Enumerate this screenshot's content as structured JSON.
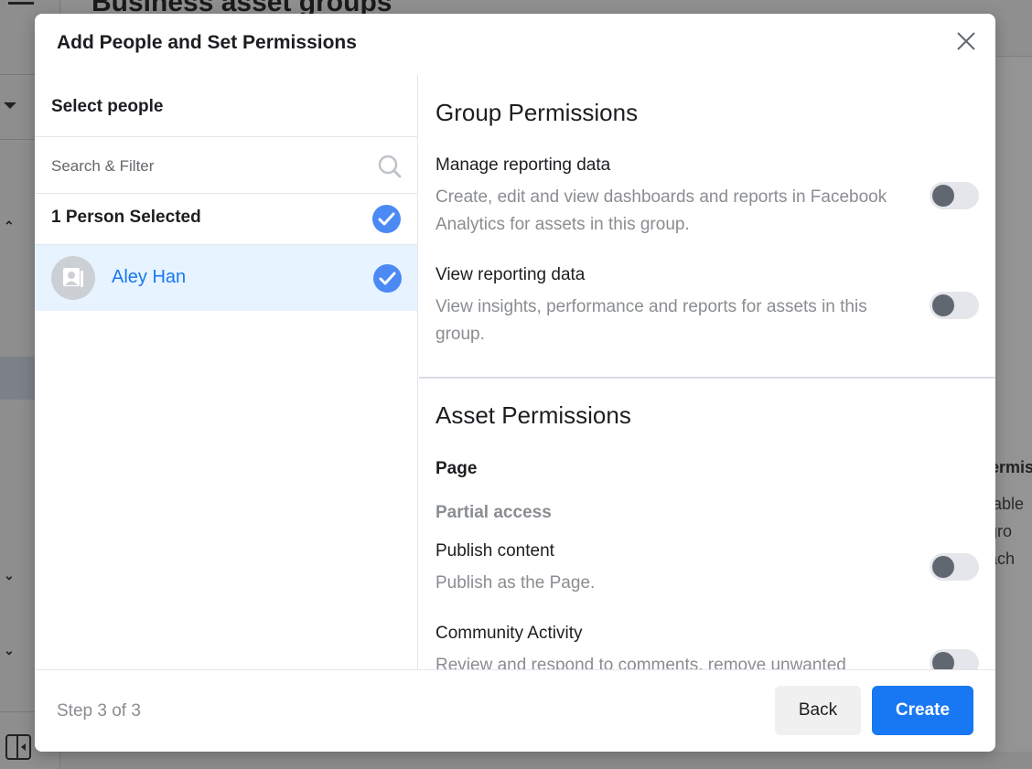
{
  "background": {
    "page_title": "Business asset groups",
    "side_text": {
      "heading": "Permiss",
      "lines": [
        "e able",
        "t gro",
        "each"
      ]
    }
  },
  "modal": {
    "title": "Add People and Set Permissions",
    "close_icon": "close-icon",
    "left": {
      "heading": "Select people",
      "search": {
        "placeholder": "Search & Filter",
        "value": ""
      },
      "selected_count_label": "1 Person Selected",
      "people": [
        {
          "name": "Aley Han",
          "selected": true
        }
      ]
    },
    "right": {
      "group_permissions": {
        "title": "Group Permissions",
        "items": [
          {
            "title": "Manage reporting data",
            "description": "Create, edit and view dashboards and reports in Facebook Analytics for assets in this group.",
            "enabled": false
          },
          {
            "title": "View reporting data",
            "description": "View insights, performance and reports for assets in this group.",
            "enabled": false
          }
        ]
      },
      "asset_permissions": {
        "title": "Asset Permissions",
        "asset_type": "Page",
        "access_level": "Partial access",
        "items": [
          {
            "title": "Publish content",
            "description": "Publish as the Page.",
            "enabled": false
          },
          {
            "title": "Community Activity",
            "description": "Review and respond to comments, remove unwanted",
            "enabled": false
          }
        ]
      }
    },
    "footer": {
      "step": "Step 3 of 3",
      "back_label": "Back",
      "create_label": "Create"
    }
  },
  "colors": {
    "primary": "#1877f2",
    "check": "#4b8af5",
    "selected_row": "#e7f3ff",
    "toggle_track": "#e4e6eb",
    "toggle_knob": "#606770"
  }
}
